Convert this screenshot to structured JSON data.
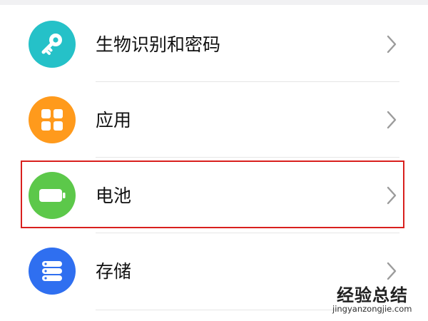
{
  "settings": {
    "items": [
      {
        "label": "生物识别和密码",
        "icon": "key-icon",
        "color": "#25c1c8"
      },
      {
        "label": "应用",
        "icon": "apps-grid-icon",
        "color": "#ff9a1c"
      },
      {
        "label": "电池",
        "icon": "battery-icon",
        "color": "#5cc84a"
      },
      {
        "label": "存储",
        "icon": "storage-icon",
        "color": "#2f6ff0"
      }
    ]
  },
  "highlight": {
    "color": "#d9201e",
    "target": "电池"
  },
  "watermark": {
    "title": "经验总结",
    "url": "jingyanzongjie.com",
    "accent": "#d9201e"
  }
}
